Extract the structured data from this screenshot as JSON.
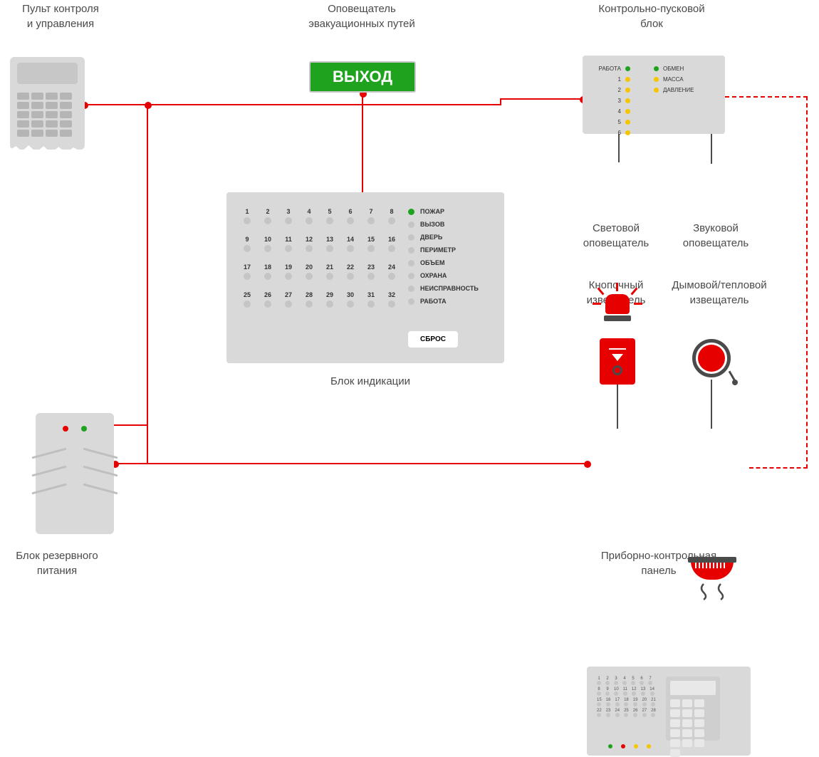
{
  "labels": {
    "keypad": "Пульт контроля\nи управления",
    "exit_sign": "Оповещатель\nэвакуационных путей",
    "control_launch": "Контрольно-пусковой\nблок",
    "indication": "Блок индикации",
    "ups": "Блок резервного\nпитания",
    "light_alarm": "Световой\nоповещатель",
    "sound_alarm": "Звуковой\nоповещатель",
    "button_det": "Кнопочный\nизвещатель",
    "smoke_det": "Дымовой/тепловой\nизвещатель",
    "control_panel": "Приборно-контрольная\nпанель"
  },
  "exit_text": "ВЫХОД",
  "clb": {
    "left": [
      {
        "label": "РАБОТА",
        "color": "g"
      },
      {
        "label": "1",
        "color": "y"
      },
      {
        "label": "2",
        "color": "y"
      },
      {
        "label": "3",
        "color": "y"
      },
      {
        "label": "4",
        "color": "y"
      },
      {
        "label": "5",
        "color": "y"
      },
      {
        "label": "6",
        "color": "y"
      }
    ],
    "right": [
      {
        "label": "ОБМЕН",
        "color": "g"
      },
      {
        "label": "МАССА",
        "color": "y"
      },
      {
        "label": "ДАВЛЕНИЕ",
        "color": "y"
      }
    ]
  },
  "indication": {
    "cells": [
      [
        "1",
        "2",
        "3",
        "4",
        "5",
        "6",
        "7",
        "8"
      ],
      [
        "9",
        "10",
        "11",
        "12",
        "13",
        "14",
        "15",
        "16"
      ],
      [
        "17",
        "18",
        "19",
        "20",
        "21",
        "22",
        "23",
        "24"
      ],
      [
        "25",
        "26",
        "27",
        "28",
        "29",
        "30",
        "31",
        "32"
      ]
    ],
    "status": [
      "ПОЖАР",
      "ВЫЗОВ",
      "ДВЕРЬ",
      "ПЕРИМЕТР",
      "ОБЪЕМ",
      "ОХРАНА",
      "НЕИСПРАВНОСТЬ",
      "РАБОТА"
    ],
    "reset": "СБРОС"
  },
  "colors": {
    "red": "#e60000",
    "green": "#1fa31f",
    "yellow": "#f7c500",
    "grey": "#d9d9d9"
  }
}
